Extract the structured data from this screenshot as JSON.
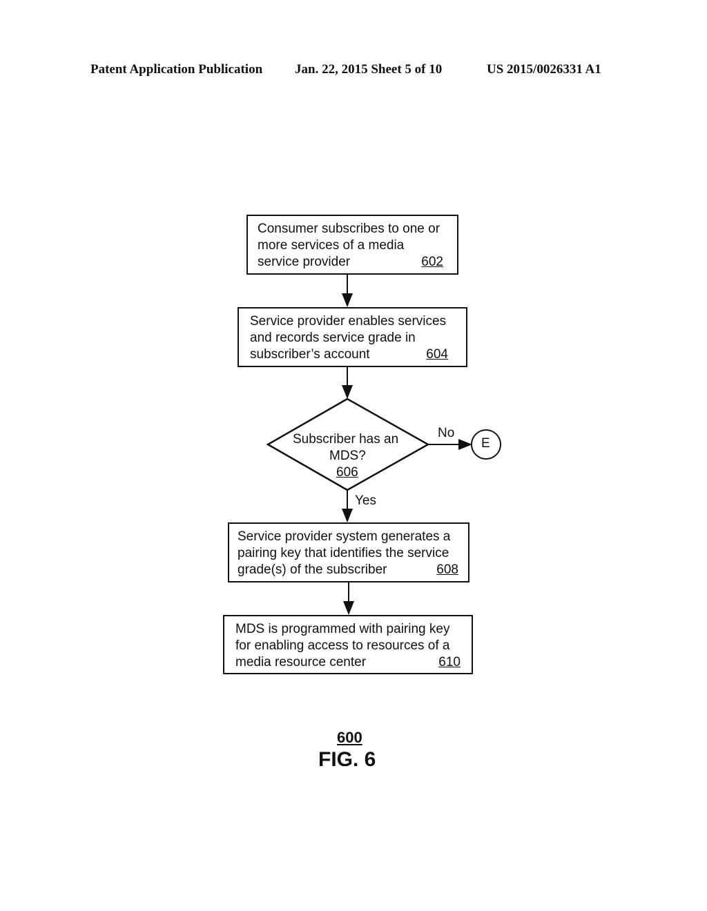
{
  "header": {
    "publication": "Patent Application Publication",
    "date_sheet": "Jan. 22, 2015  Sheet 5 of 10",
    "number": "US 2015/0026331 A1"
  },
  "steps": [
    {
      "id": "602",
      "lines": [
        "Consumer subscribes to one or",
        "more services of a media",
        "service provider"
      ]
    },
    {
      "id": "604",
      "lines": [
        "Service provider enables services",
        "and records service grade in",
        "subscriber’s account"
      ]
    },
    {
      "id": "606",
      "lines": [
        "Subscriber has an",
        "MDS?"
      ]
    },
    {
      "id": "608",
      "lines": [
        "Service provider system generates a",
        "pairing key that identifies the service",
        "grade(s) of the subscriber"
      ]
    },
    {
      "id": "610",
      "lines": [
        "MDS is programmed with pairing key",
        "for enabling access to resources of a",
        "media resource center"
      ]
    }
  ],
  "branches": {
    "no": "No",
    "yes": "Yes"
  },
  "connector": "E",
  "figure": {
    "number": "600",
    "label": "FIG. 6"
  }
}
